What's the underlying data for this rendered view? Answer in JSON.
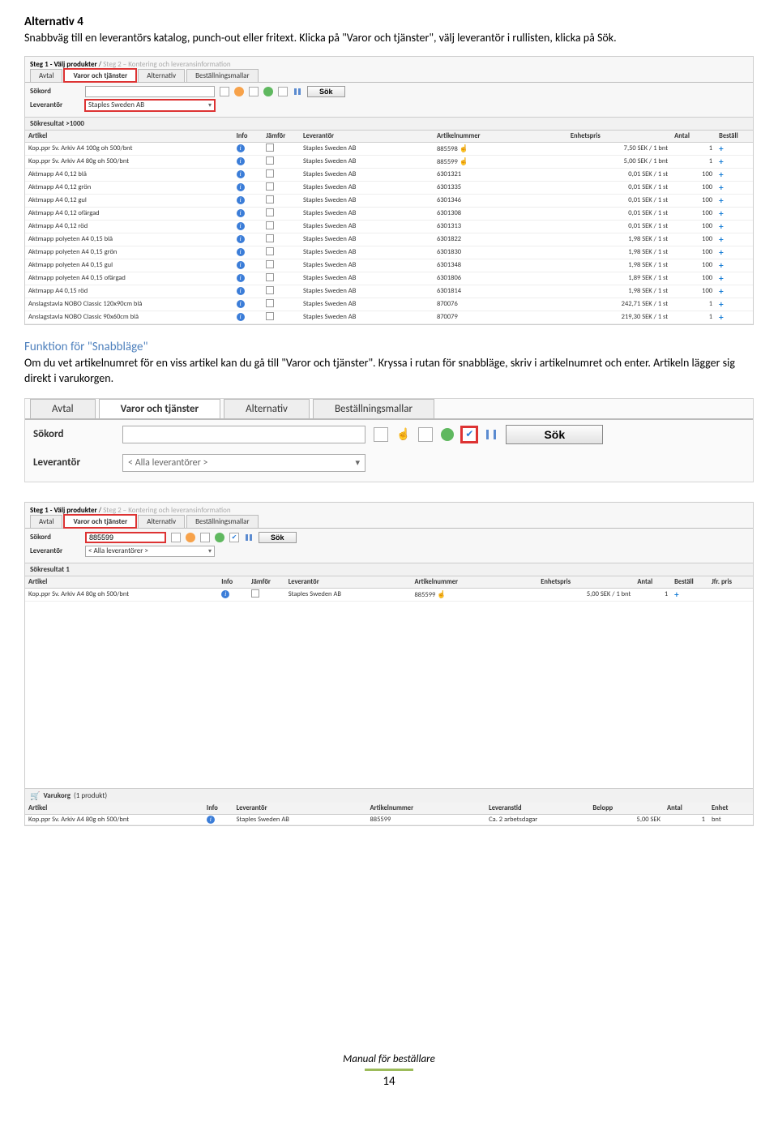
{
  "doc": {
    "alt4_title": "Alternativ 4",
    "alt4_body": "Snabbväg till en leverantörs katalog, punch-out eller fritext. Klicka på \"Varor och tjänster\", välj leverantör i rullisten, klicka på Sök.",
    "snabb_title": "Funktion för \"Snabbläge\"",
    "snabb_body": "Om du vet artikelnumret för en viss artikel kan du gå till \"Varor och tjänster\". Kryssa i rutan för snabbläge, skriv i artikelnumret och enter. Artikeln lägger sig direkt i varukorgen.",
    "footer_text": "Manual för beställare",
    "page_number": "14"
  },
  "ui": {
    "steps": {
      "active": "Steg 1 - Välj produkter",
      "sep": " / ",
      "inactive": "Steg 2 – Kontering och leveransinformation"
    },
    "tabs": {
      "avtal": "Avtal",
      "varor": "Varor och tjänster",
      "alternativ": "Alternativ",
      "mallar": "Beställningsmallar"
    },
    "labels": {
      "sokord": "Sökord",
      "leverantor": "Leverantör",
      "sok": "Sök",
      "artikel": "Artikel",
      "info": "Info",
      "jamfor": "Jämför",
      "leverantor_col": "Leverantör",
      "artikelnummer": "Artikelnummer",
      "enhetspris": "Enhetspris",
      "antal": "Antal",
      "bestall": "Beställ",
      "jfrpris": "Jfr. pris",
      "leveranstid": "Leveranstid",
      "belopp": "Belopp",
      "enhet": "Enhet",
      "varukorg": "Varukorg",
      "varukorg_count": "(1 produkt)"
    },
    "supplier_selected": "Staples Sweden AB",
    "all_suppliers": "< Alla leverantörer >",
    "result_header": "Sökresultat >1000",
    "result_header_1": "Sökresultat 1",
    "rows": [
      {
        "artikel": "Kop.ppr Sv. Arkiv A4 100g oh 500/bnt",
        "lev": "Staples Sweden AB",
        "nr": "885598",
        "pris": "7,50 SEK / 1 bnt",
        "antal": "1",
        "hand": true
      },
      {
        "artikel": "Kop.ppr Sv. Arkiv A4 80g oh 500/bnt",
        "lev": "Staples Sweden AB",
        "nr": "885599",
        "pris": "5,00 SEK / 1 bnt",
        "antal": "1",
        "hand": true
      },
      {
        "artikel": "Aktmapp A4 0,12 blå",
        "lev": "Staples Sweden AB",
        "nr": "6301321",
        "pris": "0,01 SEK / 1 st",
        "antal": "100",
        "hand": false
      },
      {
        "artikel": "Aktmapp A4 0,12 grön",
        "lev": "Staples Sweden AB",
        "nr": "6301335",
        "pris": "0,01 SEK / 1 st",
        "antal": "100",
        "hand": false
      },
      {
        "artikel": "Aktmapp A4 0,12 gul",
        "lev": "Staples Sweden AB",
        "nr": "6301346",
        "pris": "0,01 SEK / 1 st",
        "antal": "100",
        "hand": false
      },
      {
        "artikel": "Aktmapp A4 0,12 ofärgad",
        "lev": "Staples Sweden AB",
        "nr": "6301308",
        "pris": "0,01 SEK / 1 st",
        "antal": "100",
        "hand": false
      },
      {
        "artikel": "Aktmapp A4 0,12 röd",
        "lev": "Staples Sweden AB",
        "nr": "6301313",
        "pris": "0,01 SEK / 1 st",
        "antal": "100",
        "hand": false
      },
      {
        "artikel": "Aktmapp polyeten A4 0,15 blå",
        "lev": "Staples Sweden AB",
        "nr": "6301822",
        "pris": "1,98 SEK / 1 st",
        "antal": "100",
        "hand": false
      },
      {
        "artikel": "Aktmapp polyeten A4 0,15 grön",
        "lev": "Staples Sweden AB",
        "nr": "6301830",
        "pris": "1,98 SEK / 1 st",
        "antal": "100",
        "hand": false
      },
      {
        "artikel": "Aktmapp polyeten A4 0,15 gul",
        "lev": "Staples Sweden AB",
        "nr": "6301348",
        "pris": "1,98 SEK / 1 st",
        "antal": "100",
        "hand": false
      },
      {
        "artikel": "Aktmapp polyeten A4 0,15 ofärgad",
        "lev": "Staples Sweden AB",
        "nr": "6301806",
        "pris": "1,89 SEK / 1 st",
        "antal": "100",
        "hand": false
      },
      {
        "artikel": "Aktmapp A4 0,15 röd",
        "lev": "Staples Sweden AB",
        "nr": "6301814",
        "pris": "1,98 SEK / 1 st",
        "antal": "100",
        "hand": false
      },
      {
        "artikel": "Anslagstavla NOBO Classic 120x90cm blå",
        "lev": "Staples Sweden AB",
        "nr": "870076",
        "pris": "242,71 SEK / 1 st",
        "antal": "1",
        "hand": false
      },
      {
        "artikel": "Anslagstavla NOBO Classic 90x60cm blå",
        "lev": "Staples Sweden AB",
        "nr": "870079",
        "pris": "219,30 SEK / 1 st",
        "antal": "1",
        "hand": false
      }
    ],
    "row_single": {
      "artikel": "Kop.ppr Sv. Arkiv A4 80g oh 500/bnt",
      "lev": "Staples Sweden AB",
      "nr": "885599",
      "pris": "5,00 SEK / 1 bnt",
      "antal": "1"
    },
    "sokord_value": "885599",
    "cart_row": {
      "artikel": "Kop.ppr Sv. Arkiv A4 80g oh 500/bnt",
      "lev": "Staples Sweden AB",
      "nr": "885599",
      "leveranstid": "Ca. 2 arbetsdagar",
      "belopp": "5,00 SEK",
      "antal": "1",
      "enhet": "bnt"
    }
  }
}
